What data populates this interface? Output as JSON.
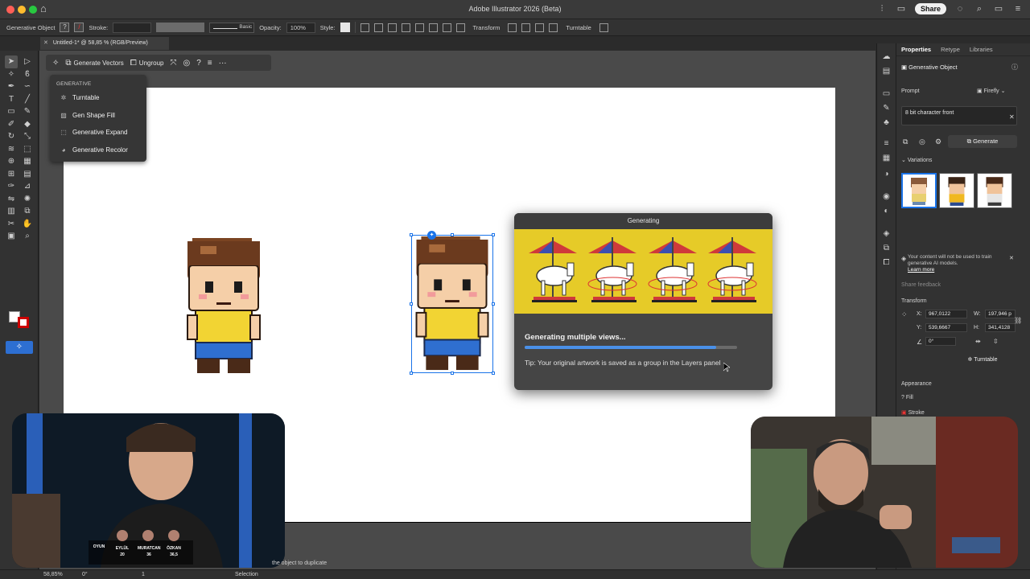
{
  "app": {
    "title": "Adobe Illustrator 2026 (Beta)",
    "share_label": "Share"
  },
  "controlbar": {
    "object_type": "Generative Object",
    "stroke_label": "Stroke:",
    "brush_label": "Basic",
    "opacity_label": "Opacity:",
    "opacity_value": "100%",
    "style_label": "Style:",
    "transform_label": "Transform",
    "turntable_label": "Turntable"
  },
  "document_tab": {
    "title": "Untitled-1* @ 58,85 % (RGB/Preview)"
  },
  "context_bar": {
    "generate_vectors": "Generate Vectors",
    "ungroup": "Ungroup"
  },
  "generative_menu": {
    "header": "GENERATIVE",
    "items": [
      "Turntable",
      "Gen Shape Fill",
      "Generative Expand",
      "Generative Recolor"
    ]
  },
  "dialog": {
    "title": "Generating",
    "heading": "Generating multiple views...",
    "progress": 0.9,
    "tip": "Tip: Your original artwork is saved as a group in the Layers panel"
  },
  "properties": {
    "tabs": [
      "Properties",
      "Retype",
      "Libraries"
    ],
    "section_title": "Generative Object",
    "prompt_label": "Prompt",
    "model_label": "Firefly",
    "prompt_text": "8 bit character front",
    "generate_label": "Generate",
    "variations_label": "Variations",
    "notice_text": "Your content will not be used to train generative AI models.",
    "learn_more": "Learn more",
    "share_feedback": "Share feedback",
    "transform_label": "Transform",
    "x_label": "X:",
    "x_value": "967,0122",
    "y_label": "Y:",
    "y_value": "539,6667",
    "w_label": "W:",
    "w_value": "197,946 p",
    "h_label": "H:",
    "h_value": "341,4128",
    "angle_value": "0°",
    "turntable_label": "Turntable",
    "appearance_label": "Appearance",
    "fill_label": "Fill",
    "stroke_label": "Stroke"
  },
  "webcam_left": {
    "scoreboard": [
      {
        "name": "OYUN",
        "score": ""
      },
      {
        "name": "EYLÜL",
        "score": "20"
      },
      {
        "name": "MURATCAN",
        "score": "36"
      },
      {
        "name": "ÖZKAN",
        "score": "36,5"
      }
    ]
  },
  "statusbar": {
    "zoom": "58,85%",
    "angle": "0°",
    "artboard": "1",
    "tool": "Selection",
    "hint": "the object to duplicate"
  },
  "colors": {
    "accent": "#1a73e8",
    "banner": "#e6cb28",
    "progress": "#4a90e8"
  }
}
